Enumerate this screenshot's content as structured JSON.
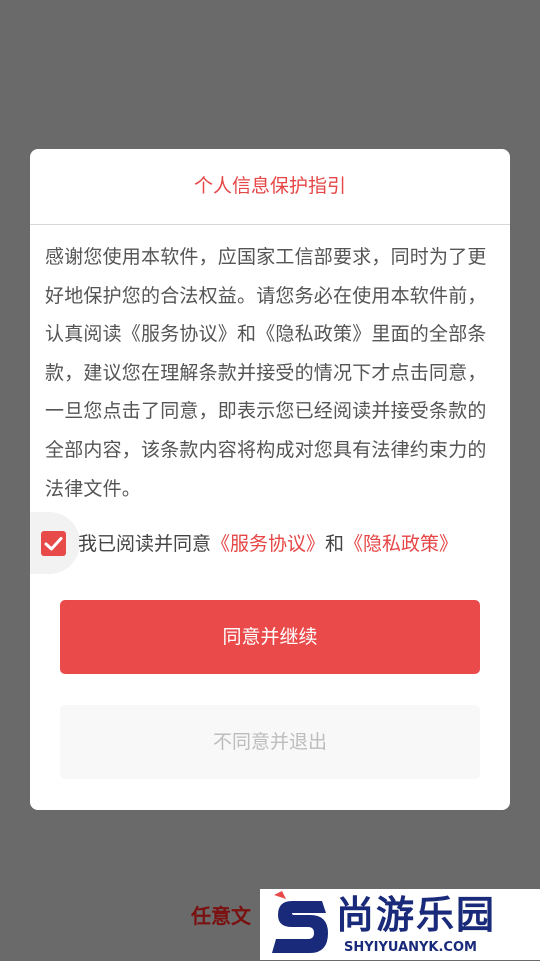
{
  "dialog": {
    "title": "个人信息保护指引",
    "body": "感谢您使用本软件，应国家工信部要求，同时为了更好地保护您的合法权益。请您务必在使用本软件前，认真阅读《服务协议》和《隐私政策》里面的全部条款，建议您在理解条款并接受的情况下才点击同意，一旦您点击了同意，即表示您已经阅读并接受条款的全部内容，该条款内容将构成对您具有法律约束力的法律文件。",
    "consent": {
      "checked": true,
      "prefix": "我已阅读并同意",
      "service_link": "《服务协议》",
      "conjunction": "和",
      "privacy_link": "《隐私政策》"
    },
    "agree_button": "同意并继续",
    "decline_button": "不同意并退出"
  },
  "background": {
    "partial_text": "任意文"
  },
  "watermark": {
    "logo_icon": "s-logo-icon",
    "title": "尚游乐园",
    "url": "SHYIYUANYK.COM"
  },
  "colors": {
    "accent": "#e84a4a",
    "overlay": "#6a6a6a",
    "watermark_text": "#1a2a7a"
  }
}
